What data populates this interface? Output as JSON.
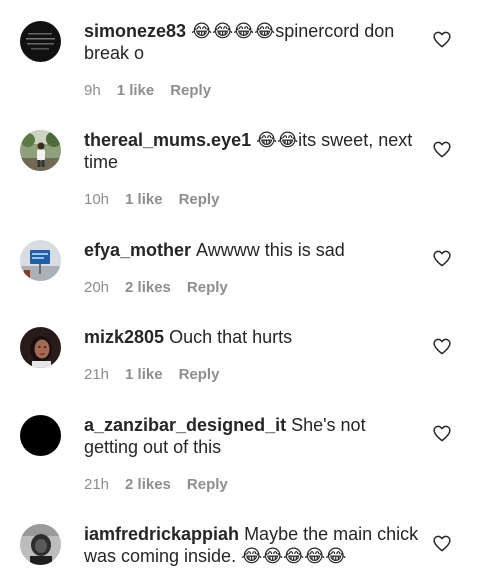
{
  "comments": [
    {
      "username": "simoneze83",
      "text": "😂😂😂😂spinercord don break o",
      "time": "9h",
      "likes": "1 like",
      "reply": "Reply",
      "avatar_icon": "dark-text-avatar"
    },
    {
      "username": "thereal_mums.eye1",
      "text": "😂😂its sweet, next time",
      "time": "10h",
      "likes": "1 like",
      "reply": "Reply",
      "avatar_icon": "outdoor-person-avatar"
    },
    {
      "username": "efya_mother",
      "text": "Awwww this is sad",
      "time": "20h",
      "likes": "2 likes",
      "reply": "Reply",
      "avatar_icon": "blue-sign-avatar"
    },
    {
      "username": "mizk2805",
      "text": "Ouch that hurts",
      "time": "21h",
      "likes": "1 like",
      "reply": "Reply",
      "avatar_icon": "portrait-avatar"
    },
    {
      "username": "a_zanzibar_designed_it",
      "text": "She's not getting out of this",
      "time": "21h",
      "likes": "2 likes",
      "reply": "Reply",
      "avatar_icon": "black-avatar"
    },
    {
      "username": "iamfredrickappiah",
      "text": "Maybe the main chick was coming inside. 😂😂😂😂😂",
      "time": "",
      "likes": "",
      "reply": "",
      "avatar_icon": "grayscale-portrait-avatar"
    }
  ],
  "colors": {
    "text": "#262626",
    "meta": "#8e8e8e",
    "background": "#ffffff"
  }
}
